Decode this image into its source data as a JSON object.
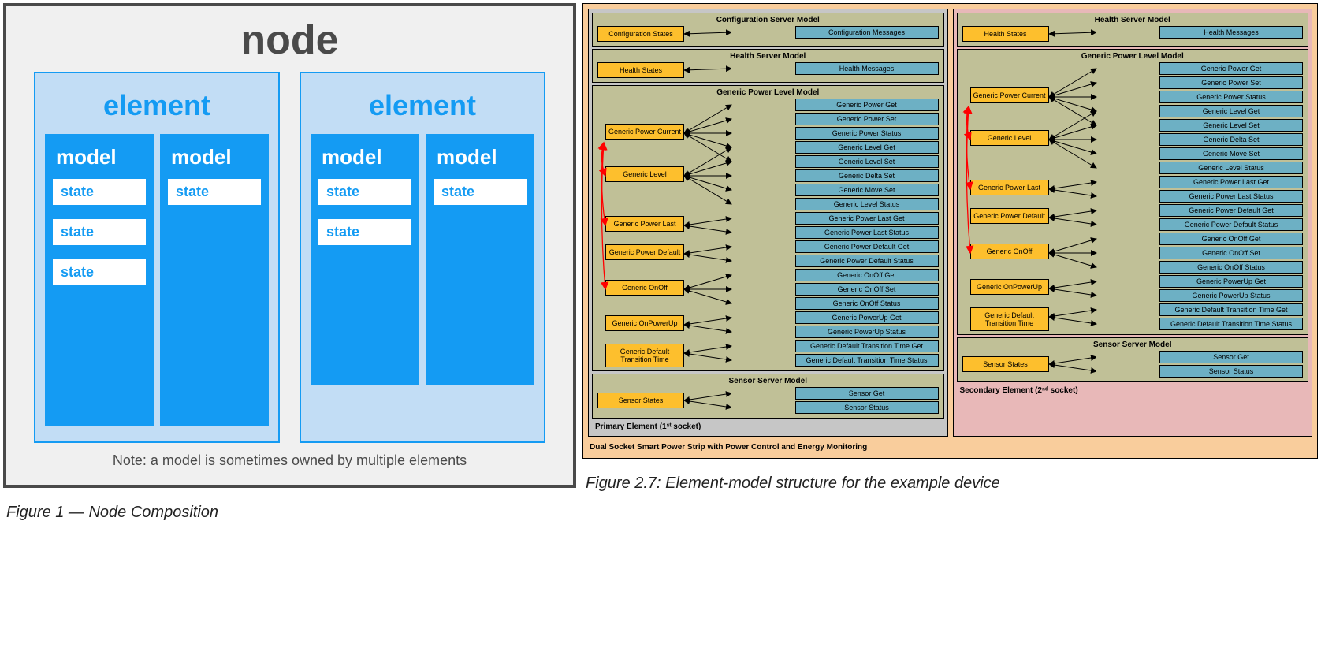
{
  "figure1": {
    "node_label": "node",
    "element_label": "element",
    "model_label": "model",
    "state_label": "state",
    "note": "Note: a model is sometimes owned by multiple elements",
    "caption": "Figure 1 — Node Composition",
    "elements": [
      {
        "models": [
          {
            "states": 3
          },
          {
            "states": 1
          }
        ]
      },
      {
        "models": [
          {
            "states": 2
          },
          {
            "states": 1
          }
        ]
      }
    ]
  },
  "figure2": {
    "caption": "Figure 2.7: Element-model structure for the example device",
    "device_label": "Dual Socket Smart Power Strip with Power Control and Energy Monitoring",
    "primary_label": "Primary Element (1ˢᵗ socket)",
    "secondary_label": "Secondary Element (2ⁿᵈ socket)",
    "config": {
      "title": "Configuration Server Model",
      "state": "Configuration States",
      "msgs": [
        "Configuration Messages"
      ]
    },
    "health": {
      "title": "Health Server Model",
      "state": "Health States",
      "msgs": [
        "Health Messages"
      ]
    },
    "power_level": {
      "title": "Generic Power Level Model",
      "states": [
        {
          "label": "Generic Power Current",
          "msg_idx": [
            0,
            1,
            2,
            3,
            4
          ]
        },
        {
          "label": "Generic Level",
          "msg_idx": [
            3,
            4,
            5,
            6,
            7
          ]
        },
        {
          "label": "Generic Power Last",
          "msg_idx": [
            8,
            9
          ]
        },
        {
          "label": "Generic Power Default",
          "msg_idx": [
            10,
            11
          ]
        },
        {
          "label": "Generic OnOff",
          "msg_idx": [
            12,
            13,
            14
          ]
        },
        {
          "label": "Generic OnPowerUp",
          "msg_idx": [
            15,
            16
          ]
        },
        {
          "label": "Generic Default Transition Time",
          "msg_idx": [
            17,
            18
          ]
        }
      ],
      "msgs": [
        "Generic Power Get",
        "Generic Power Set",
        "Generic Power Status",
        "Generic Level Get",
        "Generic Level Set",
        "Generic Delta Set",
        "Generic Move Set",
        "Generic Level Status",
        "Generic Power Last Get",
        "Generic Power Last Status",
        "Generic Power Default Get",
        "Generic Power Default Status",
        "Generic OnOff Get",
        "Generic OnOff Set",
        "Generic OnOff Status",
        "Generic PowerUp Get",
        "Generic PowerUp Status",
        "Generic Default Transition Time Get",
        "Generic Default Transition Time Status"
      ]
    },
    "sensor": {
      "title": "Sensor Server Model",
      "state": "Sensor States",
      "msgs": [
        "Sensor Get",
        "Sensor Status"
      ]
    }
  }
}
